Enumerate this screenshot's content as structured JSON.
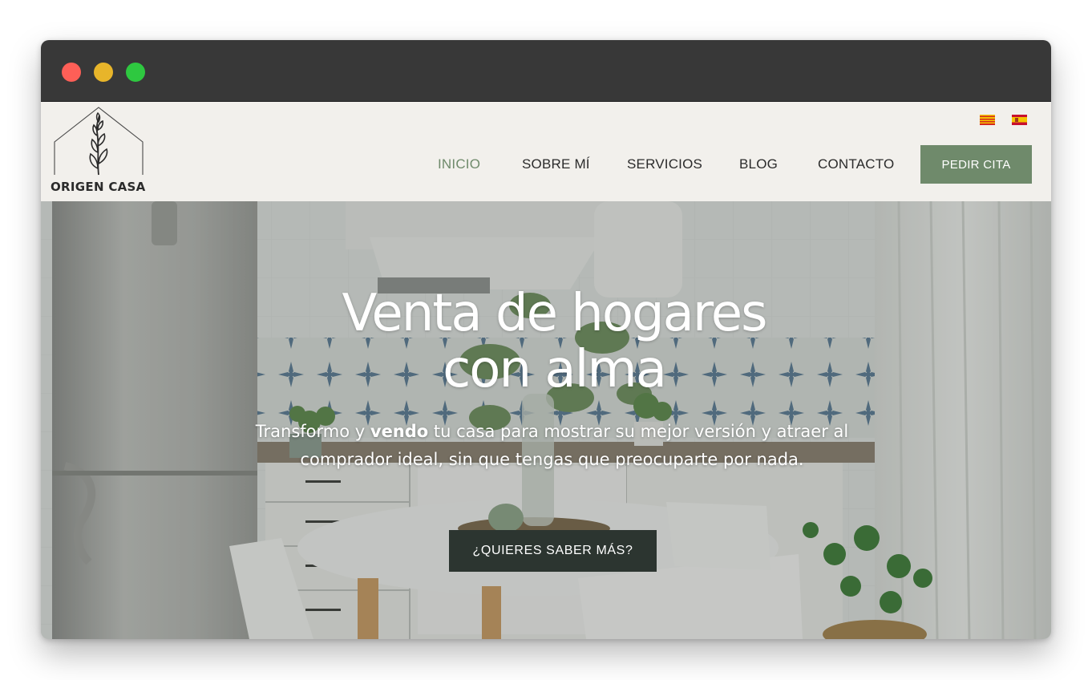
{
  "window": {
    "controls": [
      "close",
      "minimize",
      "maximize"
    ]
  },
  "header": {
    "logo_text": "ORIGEN CASA",
    "languages": [
      {
        "code": "ca",
        "icon": "catalan-flag-icon"
      },
      {
        "code": "es",
        "icon": "spanish-flag-icon"
      }
    ],
    "nav": [
      {
        "label": "INICIO",
        "active": true
      },
      {
        "label": "SOBRE MÍ",
        "active": false
      },
      {
        "label": "SERVICIOS",
        "active": false
      },
      {
        "label": "BLOG",
        "active": false
      },
      {
        "label": "CONTACTO",
        "active": false
      }
    ],
    "cta_label": "PEDIR CITA"
  },
  "hero": {
    "title_line1": "Venta de hogares",
    "title_line2": "con alma",
    "subtitle_before": "Transformo y ",
    "subtitle_bold": "vendo",
    "subtitle_after": " tu casa para mostrar su mejor versión y atraer al comprador ideal, sin que tengas que preocuparte por nada.",
    "button_label": "¿QUIERES SABER MÁS?"
  },
  "colors": {
    "accent": "#6f8a6b",
    "dark_button": "#2c3530",
    "header_bg": "#f2f0ec",
    "titlebar": "#383838"
  }
}
